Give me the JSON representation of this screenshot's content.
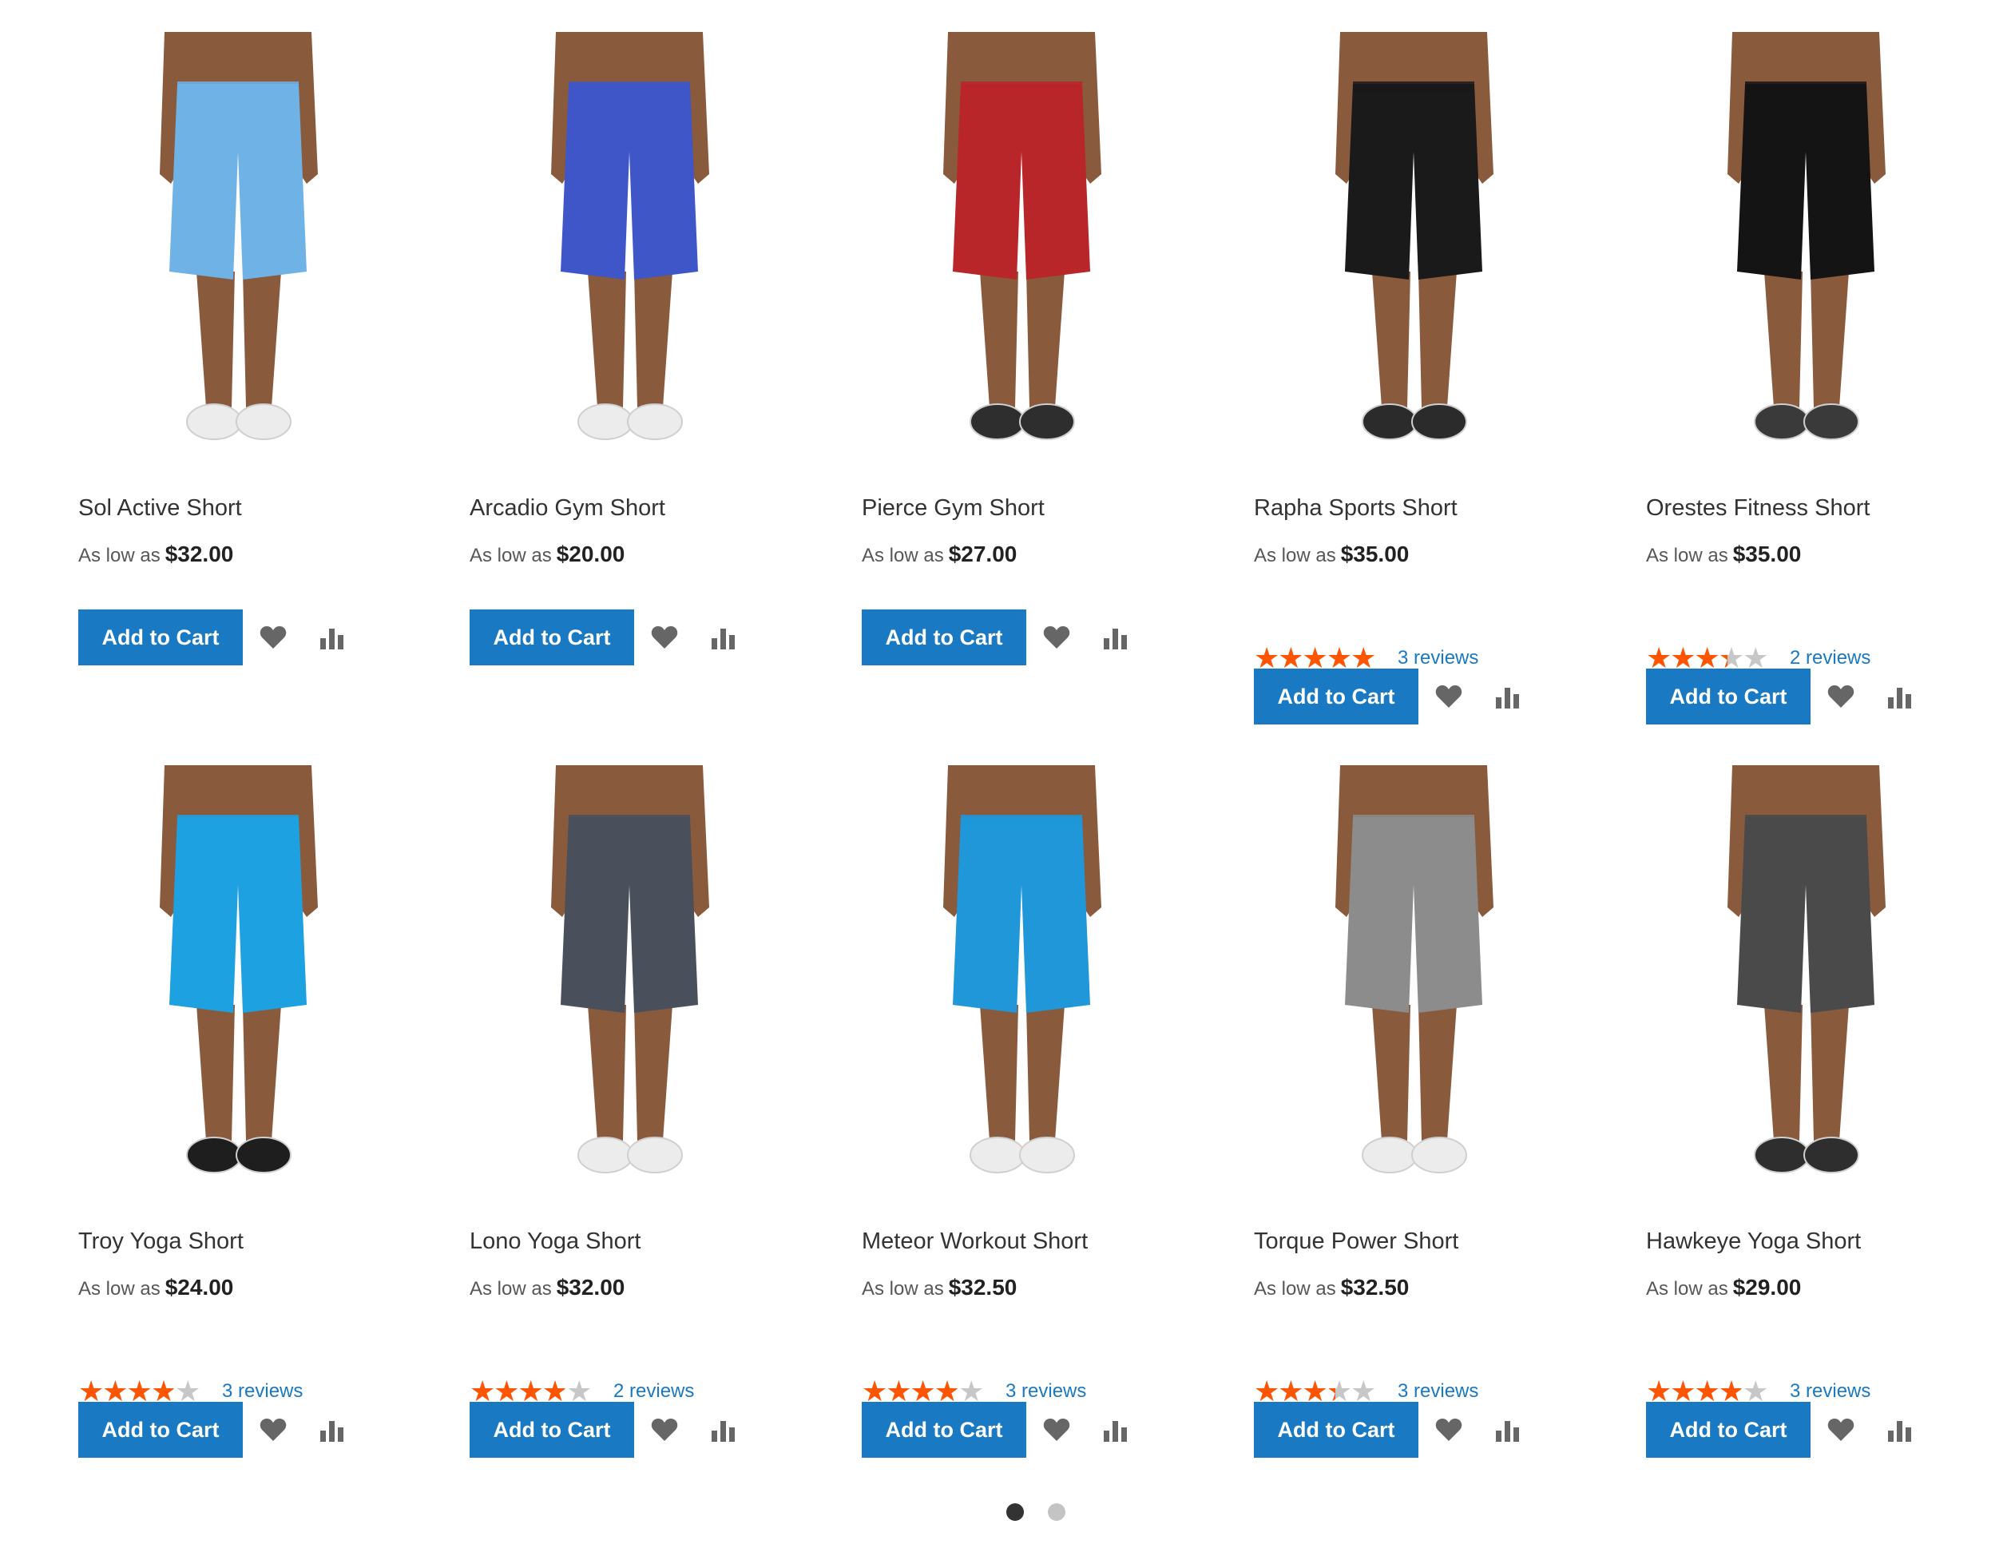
{
  "pager": {
    "active": 0,
    "count": 2
  },
  "colors": {
    "accent": "#1979c3",
    "star_on": "#ff5501",
    "star_off": "#c7c7c7",
    "skin": "#8a5a3c"
  },
  "products": [
    {
      "name": "Sol Active Short",
      "price_prefix": "As low as",
      "price": "$32.00",
      "rating": null,
      "reviews": null,
      "cart_label": "Add to Cart",
      "short_color": "#6fb2e6",
      "shoe_color": "#ececec",
      "wishlist_icon": "heart-icon",
      "compare_icon": "bar-chart-icon"
    },
    {
      "name": "Arcadio Gym Short",
      "price_prefix": "As low as",
      "price": "$20.00",
      "rating": null,
      "reviews": null,
      "cart_label": "Add to Cart",
      "short_color": "#3f56c9",
      "shoe_color": "#ececec",
      "wishlist_icon": "heart-icon",
      "compare_icon": "bar-chart-icon"
    },
    {
      "name": "Pierce Gym Short",
      "price_prefix": "As low as",
      "price": "$27.00",
      "rating": null,
      "reviews": null,
      "cart_label": "Add to Cart",
      "short_color": "#b8262a",
      "shoe_color": "#2e2e2e",
      "wishlist_icon": "heart-icon",
      "compare_icon": "bar-chart-icon"
    },
    {
      "name": "Rapha Sports Short",
      "price_prefix": "As low as",
      "price": "$35.00",
      "rating": 4.5,
      "reviews": "3 reviews",
      "cart_label": "Add to Cart",
      "short_color": "#1a1a1a",
      "shoe_color": "#2b2b2b",
      "wishlist_icon": "heart-icon",
      "compare_icon": "bar-chart-icon"
    },
    {
      "name": "Orestes Fitness Short",
      "price_prefix": "As low as",
      "price": "$35.00",
      "rating": 3,
      "reviews": "2 reviews",
      "cart_label": "Add to Cart",
      "short_color": "#141414",
      "shoe_color": "#3a3a3a",
      "wishlist_icon": "heart-icon",
      "compare_icon": "bar-chart-icon"
    },
    {
      "name": "Troy Yoga Short",
      "price_prefix": "As low as",
      "price": "$24.00",
      "rating": 3.5,
      "reviews": "3 reviews",
      "cart_label": "Add to Cart",
      "short_color": "#1ea1e0",
      "shoe_color": "#1e1e1e",
      "wishlist_icon": "heart-icon",
      "compare_icon": "bar-chart-icon"
    },
    {
      "name": "Lono Yoga Short",
      "price_prefix": "As low as",
      "price": "$32.00",
      "rating": 3.5,
      "reviews": "2 reviews",
      "cart_label": "Add to Cart",
      "short_color": "#4a4f5c",
      "shoe_color": "#ececec",
      "wishlist_icon": "heart-icon",
      "compare_icon": "bar-chart-icon"
    },
    {
      "name": "Meteor Workout Short",
      "price_prefix": "As low as",
      "price": "$32.50",
      "rating": 3.5,
      "reviews": "3 reviews",
      "cart_label": "Add to Cart",
      "short_color": "#1f97d8",
      "shoe_color": "#ececec",
      "wishlist_icon": "heart-icon",
      "compare_icon": "bar-chart-icon"
    },
    {
      "name": "Torque Power Short",
      "price_prefix": "As low as",
      "price": "$32.50",
      "rating": 3,
      "reviews": "3 reviews",
      "cart_label": "Add to Cart",
      "short_color": "#8c8c8c",
      "shoe_color": "#ececec",
      "wishlist_icon": "heart-icon",
      "compare_icon": "bar-chart-icon"
    },
    {
      "name": "Hawkeye Yoga Short",
      "price_prefix": "As low as",
      "price": "$29.00",
      "rating": 3.5,
      "reviews": "3 reviews",
      "cart_label": "Add to Cart",
      "short_color": "#4a4a4a",
      "shoe_color": "#2e2e2e",
      "wishlist_icon": "heart-icon",
      "compare_icon": "bar-chart-icon"
    }
  ]
}
